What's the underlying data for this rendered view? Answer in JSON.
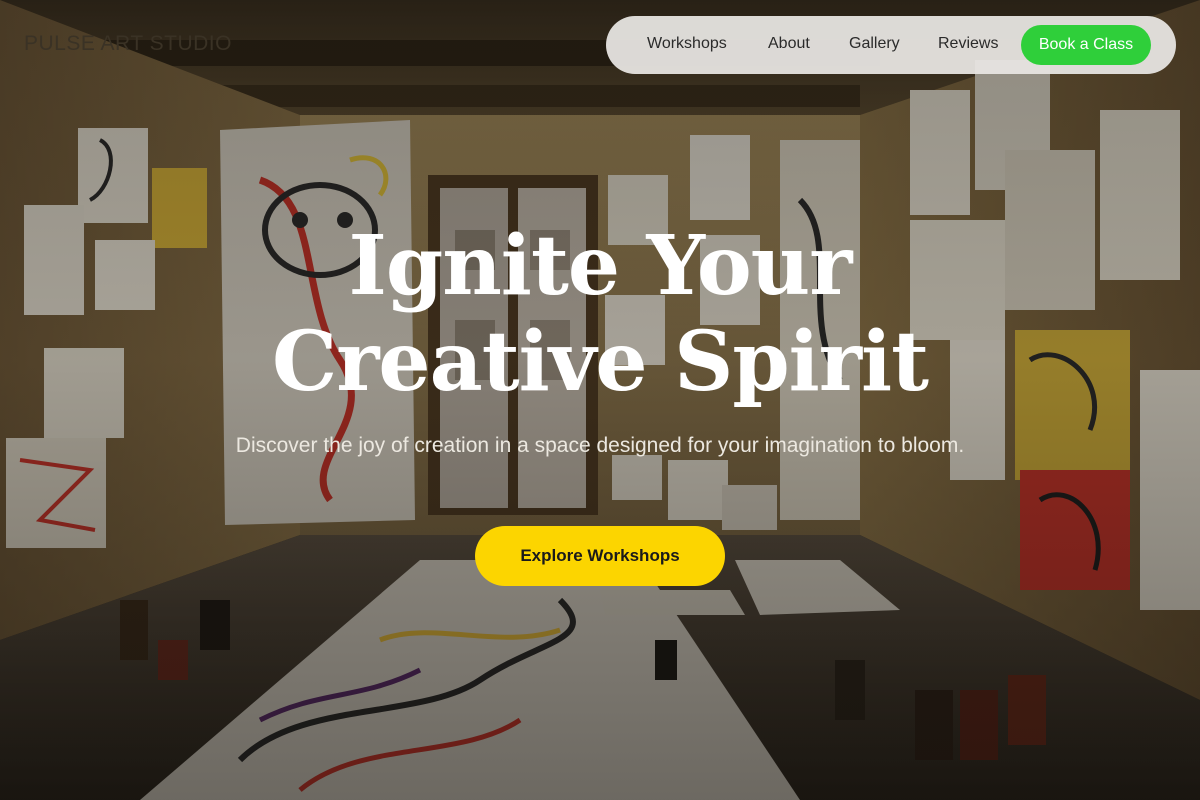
{
  "brand": {
    "name": "PULSE ART STUDIO"
  },
  "nav": {
    "links": [
      "Workshops",
      "About",
      "Gallery",
      "Reviews"
    ],
    "cta_label": "Book a Class"
  },
  "hero": {
    "headline_line1": "Ignite Your",
    "headline_line2": "Creative Spirit",
    "subtitle": "Discover the joy of creation in a space designed for your imagination to bloom.",
    "cta_label": "Explore Workshops",
    "background_image": "art-studio-room-photo"
  },
  "colors": {
    "nav_cta": "#2fcf3a",
    "hero_cta": "#fcd500",
    "nav_bg": "#e8e6e2",
    "headline": "#ffffff"
  }
}
